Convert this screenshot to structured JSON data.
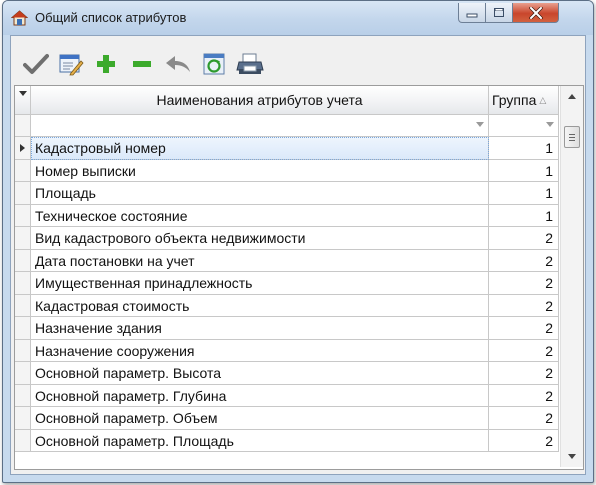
{
  "window": {
    "title": "Общий список атрибутов",
    "accent": "#c7daee",
    "close_color": "#c9462c"
  },
  "toolbar": [
    {
      "id": "apply",
      "icon": "checkmark-icon"
    },
    {
      "id": "edit",
      "icon": "edit-form-icon"
    },
    {
      "id": "add",
      "icon": "plus-icon"
    },
    {
      "id": "remove",
      "icon": "minus-icon"
    },
    {
      "id": "undo",
      "icon": "undo-arrow-icon"
    },
    {
      "id": "refresh",
      "icon": "refresh-icon"
    },
    {
      "id": "print",
      "icon": "printer-icon"
    }
  ],
  "grid": {
    "columns": [
      {
        "key": "name",
        "label": "Наименования атрибутов учета"
      },
      {
        "key": "group",
        "label": "Группа"
      }
    ],
    "sort_indicator": "△",
    "selected_row": 0,
    "rows": [
      {
        "name": "Кадастровый номер",
        "group": "1"
      },
      {
        "name": "Номер выписки",
        "group": "1"
      },
      {
        "name": "Площадь",
        "group": "1"
      },
      {
        "name": "Техническое состояние",
        "group": "1"
      },
      {
        "name": "Вид кадастрового объекта недвижимости",
        "group": "2"
      },
      {
        "name": "Дата постановки на учет",
        "group": "2"
      },
      {
        "name": "Имущественная принадлежность",
        "group": "2"
      },
      {
        "name": "Кадастровая стоимость",
        "group": "2"
      },
      {
        "name": "Назначение здания",
        "group": "2"
      },
      {
        "name": "Назначение сооружения",
        "group": "2"
      },
      {
        "name": "Основной параметр. Высота",
        "group": "2"
      },
      {
        "name": "Основной параметр. Глубина",
        "group": "2"
      },
      {
        "name": "Основной параметр. Объем",
        "group": "2"
      },
      {
        "name": "Основной параметр. Площадь",
        "group": "2"
      }
    ]
  }
}
